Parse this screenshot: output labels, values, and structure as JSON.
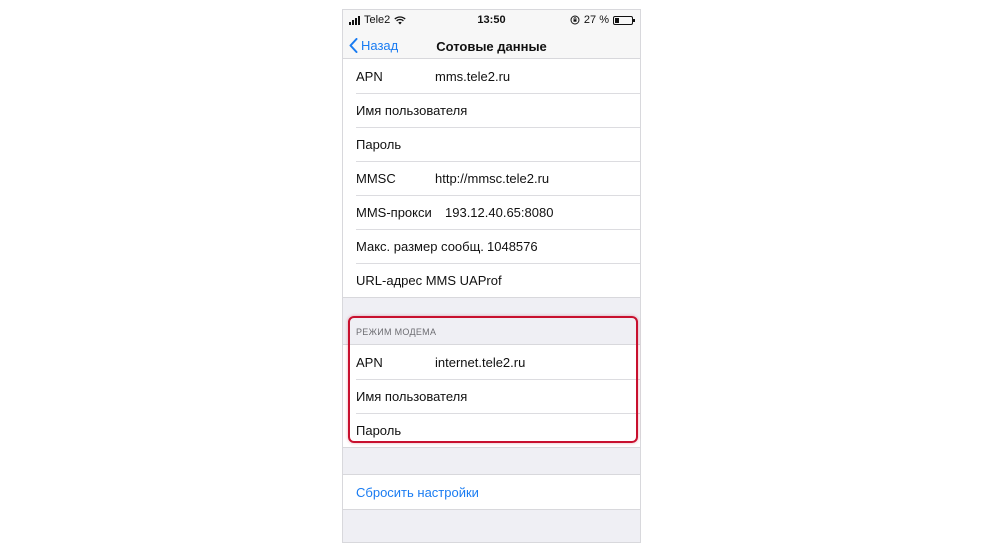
{
  "status_bar": {
    "carrier": "Tele2",
    "time": "13:50",
    "battery": "27 %",
    "battery_level": 0.27
  },
  "nav": {
    "back_label": "Назад",
    "title": "Сотовые данные"
  },
  "mms_settings": [
    {
      "label": "APN",
      "value": "mms.tele2.ru"
    },
    {
      "label": "Имя пользователя",
      "value": ""
    },
    {
      "label": "Пароль",
      "value": ""
    },
    {
      "label": "MMSC",
      "value": "http://mmsc.tele2.ru"
    },
    {
      "label": "MMS-прокси",
      "value": "193.12.40.65:8080"
    },
    {
      "label": "Макс. размер сообщ.",
      "value": "1048576"
    },
    {
      "label": "URL-адрес MMS UAProf",
      "value": ""
    }
  ],
  "modem_section": {
    "header": "РЕЖИМ МОДЕМА",
    "rows": [
      {
        "label": "APN",
        "value": "internet.tele2.ru"
      },
      {
        "label": "Имя пользователя",
        "value": ""
      },
      {
        "label": "Пароль",
        "value": ""
      }
    ]
  },
  "reset": {
    "label": "Сбросить настройки"
  },
  "colors": {
    "accent": "#1a7cf2",
    "highlight": "#c8102e",
    "background": "#efeff4"
  }
}
